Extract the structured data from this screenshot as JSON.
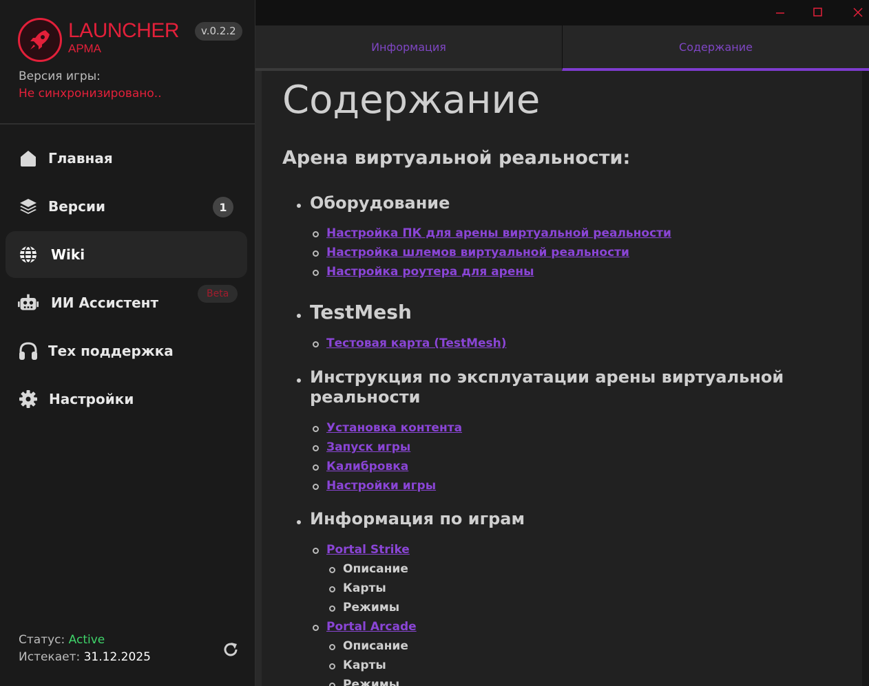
{
  "app": {
    "title": "LAUNCHER",
    "subtitle": "АРМА",
    "version": "v.0.2.2",
    "game_version_label": "Версия игры:",
    "game_version_value": "Не синхронизировано.."
  },
  "nav": {
    "items": [
      {
        "label": "Главная",
        "icon": "home-icon"
      },
      {
        "label": "Версии",
        "icon": "layers-icon",
        "badge": "1"
      },
      {
        "label": "Wiki",
        "icon": "globe-icon"
      },
      {
        "label": "ИИ Ассистент",
        "icon": "robot-icon",
        "badge": "Beta"
      },
      {
        "label": "Тех поддержка",
        "icon": "headphones-icon"
      },
      {
        "label": "Настройки",
        "icon": "gear-icon"
      }
    ]
  },
  "status": {
    "label": "Статус:",
    "value": "Active",
    "expires_label": "Истекает:",
    "expires_value": "31.12.2025"
  },
  "tabs": [
    "Информация",
    "Содержание"
  ],
  "content": {
    "title": "Содержание",
    "heading": "Арена виртуальной реальности:",
    "sections": [
      {
        "title": "Оборудование",
        "links": [
          "Настройка ПК для арены виртуальной реальности",
          "Настройка шлемов виртуальной реальности",
          "Настройка роутера для арены"
        ]
      },
      {
        "title": "TestMesh",
        "links": [
          "Тестовая карта (TestMesh)"
        ]
      },
      {
        "title": "Инструкция по эксплуатации арены виртуальной реальности",
        "title_line1": "Инструкция по эксплуатации арены виртуальной",
        "title_line2": "реальности",
        "links": [
          "Установка контента",
          "Запуск игры",
          "Калибровка",
          "Настройки игры"
        ]
      },
      {
        "title": "Информация по играм",
        "games": [
          {
            "name": "Portal Strike",
            "items": [
              "Описание",
              "Карты",
              "Режимы"
            ]
          },
          {
            "name": "Portal Arcade",
            "items": [
              "Описание",
              "Карты",
              "Режимы"
            ]
          }
        ]
      }
    ]
  },
  "colors": {
    "accent_red": "#e3203a",
    "accent_purple": "#7e3ccf",
    "status_green": "#3fd46a"
  }
}
